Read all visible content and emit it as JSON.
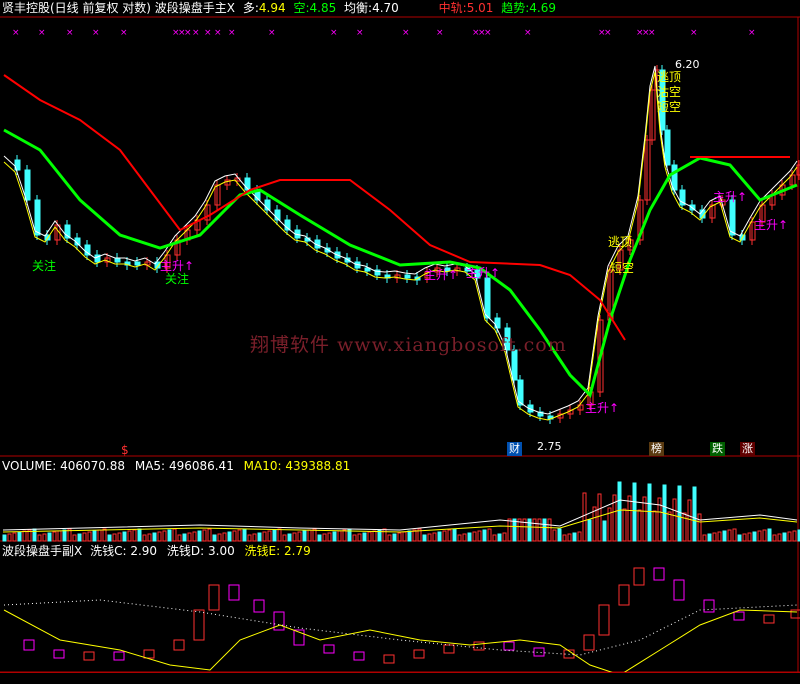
{
  "main_header": {
    "title": "贤丰控股(日线 前复权 对数) 波段操盘手主X",
    "duo_label": "多:",
    "duo_value": "4.94",
    "kong_label": "空:",
    "kong_value": "4.85",
    "junheng_label": "均衡:",
    "junheng_value": "4.70",
    "zhonggui_label": "中轨:",
    "zhonggui_value": "5.01",
    "qushi_label": "趋势:",
    "qushi_value": "4.69"
  },
  "watermark": "翔博软件 www.xiangbosoft.com",
  "annotations": {
    "guanzhu_1": "关注",
    "guanzhu_2": "关注",
    "zhusheng_1": "主升↑",
    "zhusheng_2": "主升↑",
    "zhusheng_3": "主升↑",
    "zhusheng_4": "主升↑",
    "zhusheng_5": "主升↑",
    "zhusheng_6": "主升↑",
    "taoding_1": "逃顶",
    "taoding_2": "逃顶",
    "duankong_1": "短空",
    "duankong_2": "短空",
    "gukong": "沽空",
    "high_price": "6.20",
    "low_price": "2.75",
    "marker_dollar": "$",
    "marker_cai": "财",
    "marker_bang": "榜",
    "marker_die": "跌",
    "marker_zhang": "涨"
  },
  "volume_header": {
    "label": "VOLUME:",
    "value": "406070.88",
    "ma5_label": "MA5:",
    "ma5_value": "496086.41",
    "ma10_label": "MA10:",
    "ma10_value": "439388.81"
  },
  "sub_header": {
    "title": "波段操盘手副X",
    "c_label": "洗钱C:",
    "c_value": "2.90",
    "d_label": "洗钱D:",
    "d_value": "3.00",
    "e_label": "洗钱E:",
    "e_value": "2.79"
  },
  "colors": {
    "up": "#ff3030",
    "down": "#40ffff",
    "ma_green": "#00ff00",
    "ma_red": "#ff0000",
    "ma_white": "#ffffff",
    "ma_yellow": "#ffff00",
    "magenta": "#ff00ff",
    "border": "#b00000"
  }
}
